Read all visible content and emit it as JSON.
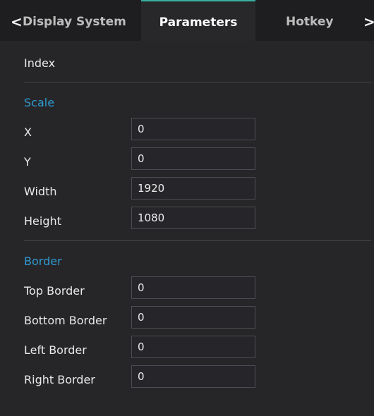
{
  "tabs": {
    "back_arrow": "<",
    "forward_arrow": ">",
    "items": [
      {
        "label": "Display System"
      },
      {
        "label": "Parameters"
      },
      {
        "label": "Hotkey"
      }
    ]
  },
  "index_label": "Index",
  "scale": {
    "title": "Scale",
    "fields": [
      {
        "label": "X",
        "value": "0"
      },
      {
        "label": "Y",
        "value": "0"
      },
      {
        "label": "Width",
        "value": "1920"
      },
      {
        "label": "Height",
        "value": "1080"
      }
    ]
  },
  "border": {
    "title": "Border",
    "fields": [
      {
        "label": "Top Border",
        "value": "0"
      },
      {
        "label": "Bottom Border",
        "value": "0"
      },
      {
        "label": "Left Border",
        "value": "0"
      },
      {
        "label": "Right Border",
        "value": "0"
      }
    ]
  },
  "colors": {
    "accent": "#2f9ad0",
    "active_tab_line": "#38b1a0",
    "background": "#262629"
  }
}
